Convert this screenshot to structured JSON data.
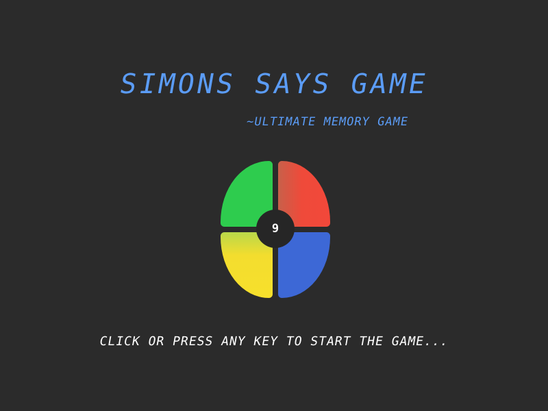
{
  "game": {
    "title": "SIMONS SAYS GAME",
    "subtitle": "~ULTIMATE MEMORY GAME",
    "prompt": "CLICK OR PRESS ANY KEY TO START THE GAME...",
    "level": "9"
  },
  "pads": [
    {
      "name": "green",
      "color": "#2ecc4e"
    },
    {
      "name": "red",
      "color": "#f2483a"
    },
    {
      "name": "yellow",
      "color": "#f7e02c"
    },
    {
      "name": "blue",
      "color": "#3d68d6"
    }
  ],
  "colors": {
    "background": "#2b2b2b",
    "title": "#5b9cf6",
    "prompt": "#ffffff",
    "center": "#262626"
  }
}
